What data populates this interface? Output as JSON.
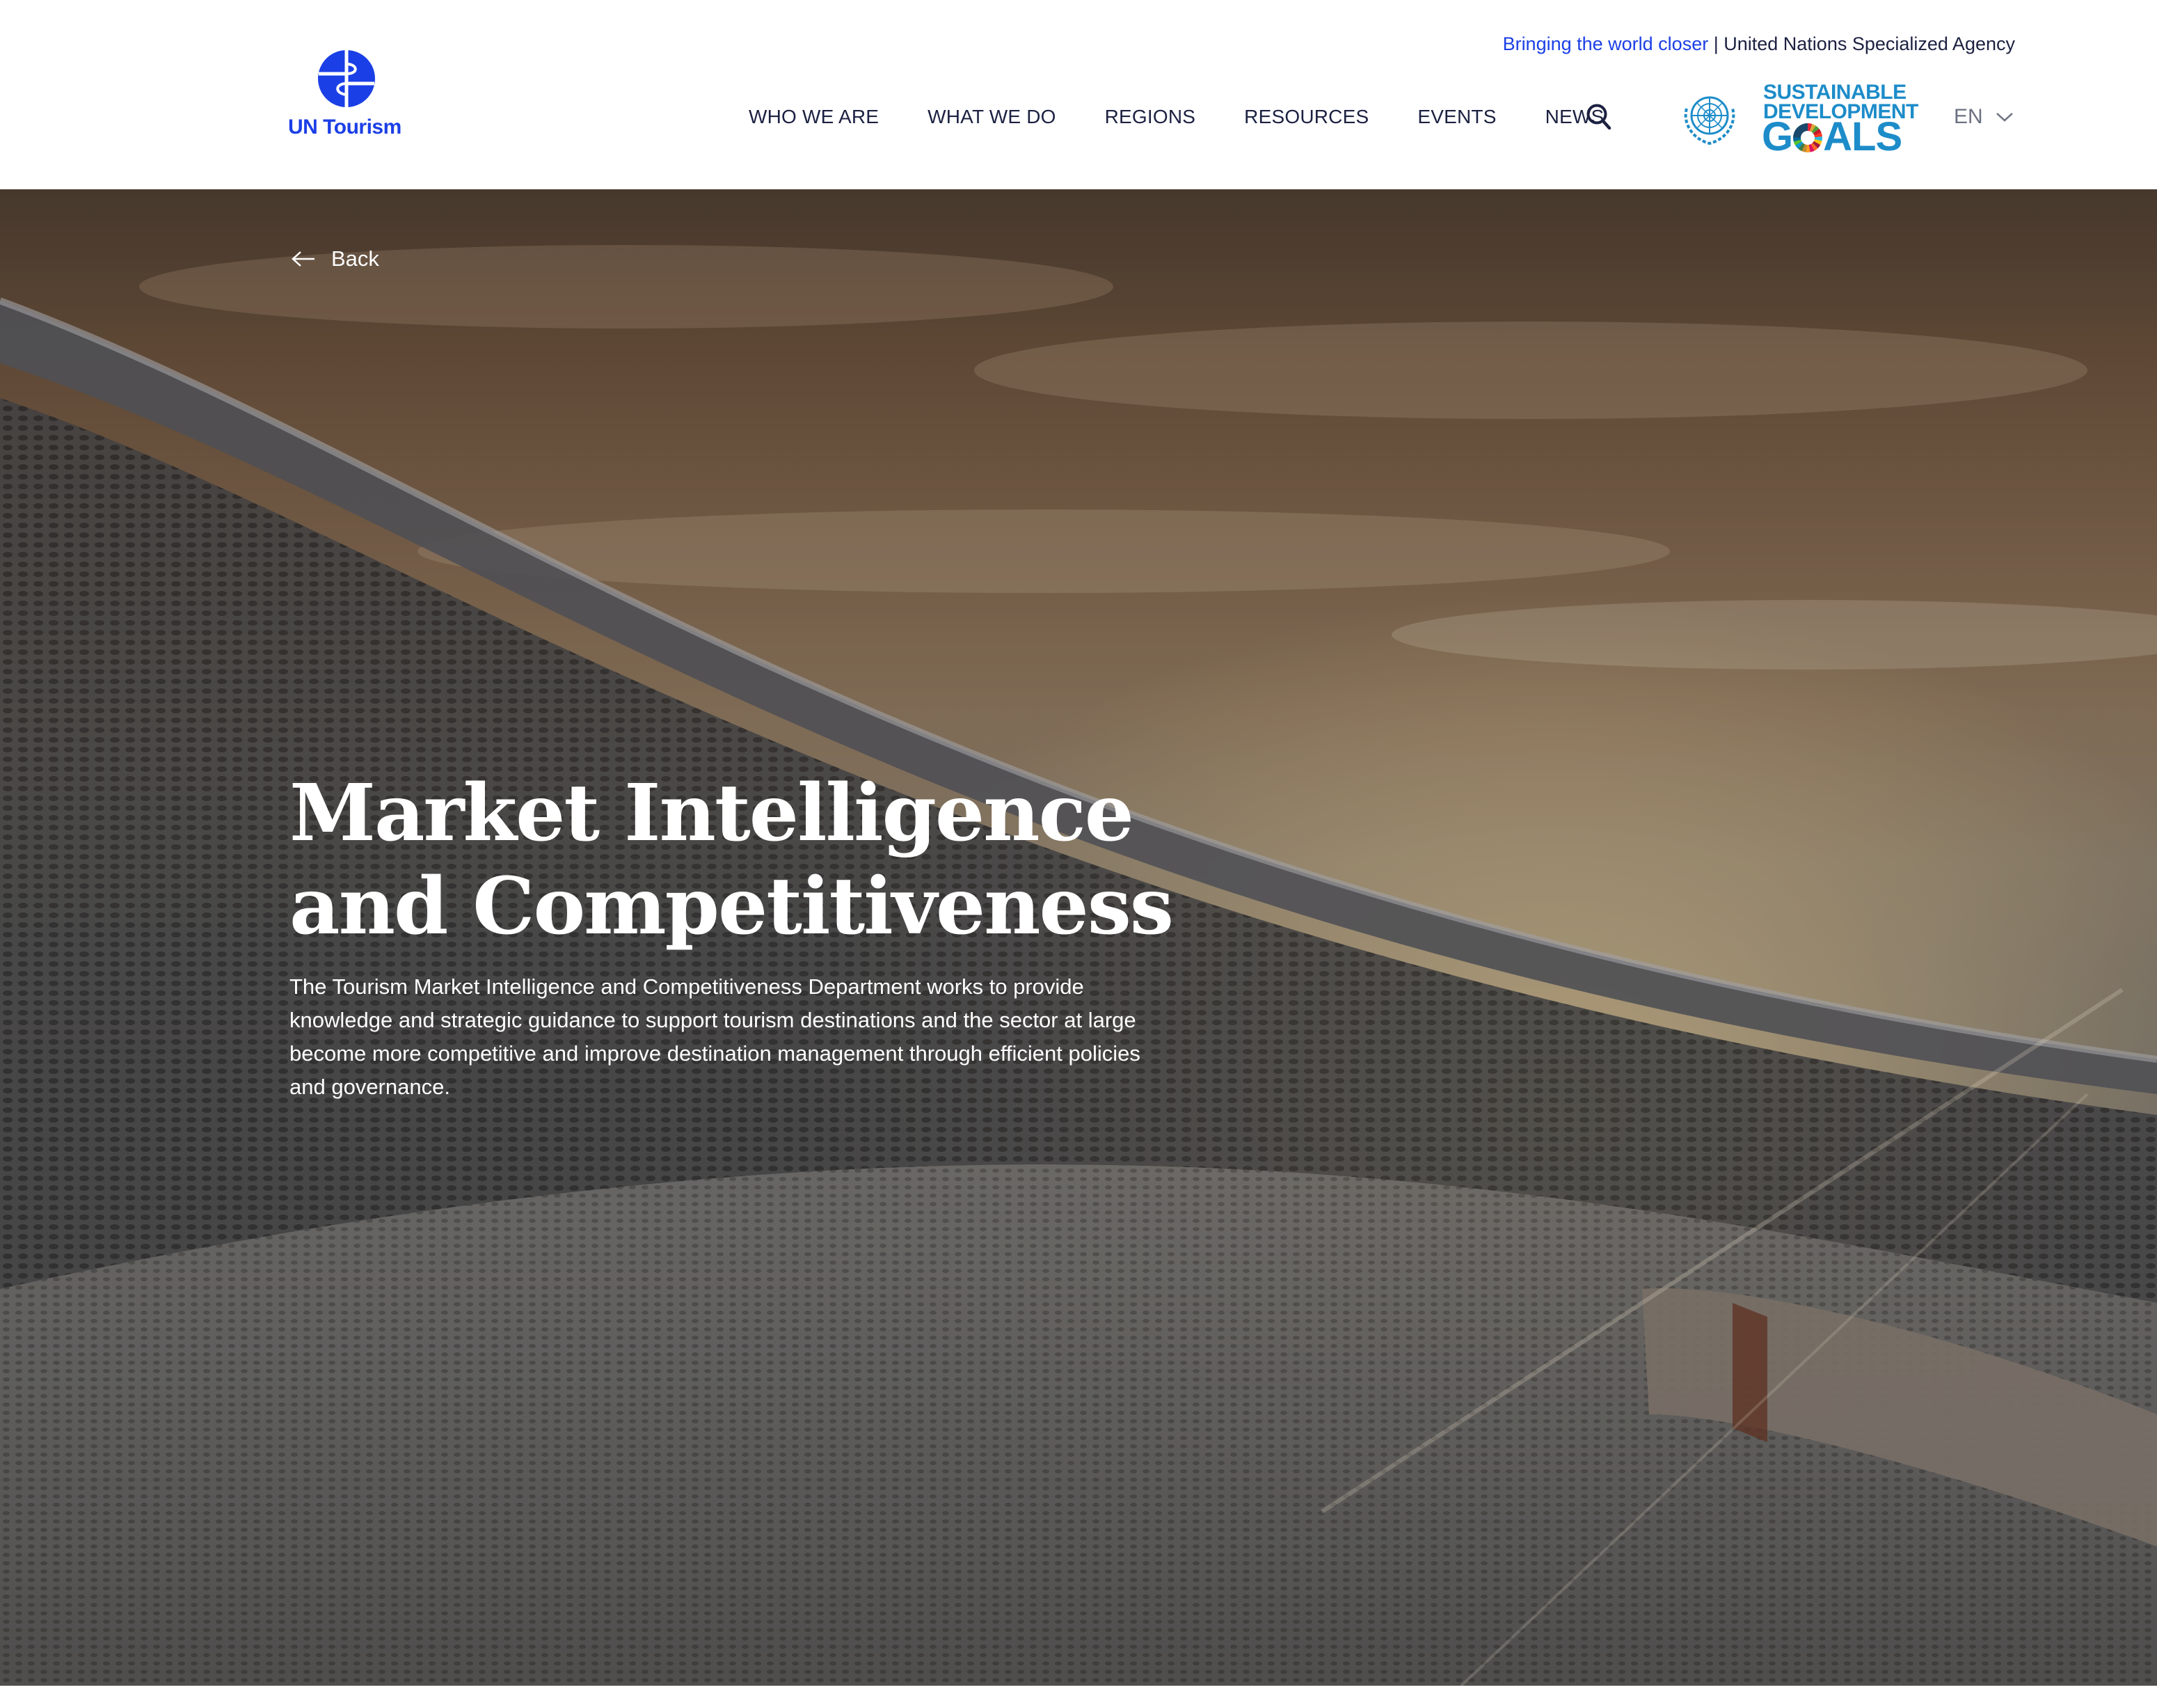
{
  "header": {
    "logo_text": "UN Tourism",
    "tagline_accent": "Bringing the world closer",
    "tagline_rest": " | United Nations Specialized Agency",
    "nav": [
      {
        "label": "WHO WE ARE"
      },
      {
        "label": "WHAT WE DO"
      },
      {
        "label": "REGIONS"
      },
      {
        "label": "RESOURCES"
      },
      {
        "label": "EVENTS"
      },
      {
        "label": "NEWS"
      }
    ],
    "search_icon": "search-icon",
    "sdg": {
      "line1": "SUSTAINABLE",
      "line2": "DEVELOPMENT",
      "goals_g": "G",
      "goals_rest": "ALS"
    },
    "language": "EN"
  },
  "hero": {
    "back_label": "Back",
    "title": "Market Intelligence and Competitiveness",
    "description": "The Tourism Market Intelligence and Competitiveness Department works to provide knowledge and strategic guidance to support tourism destinations and the sector at large become more competitive and improve destination management through efficient policies and governance."
  },
  "colors": {
    "brand_blue": "#1b3fe6",
    "nav_text": "#1c2141",
    "sdg_blue": "#1d8cc9",
    "hero_text": "#ffffff"
  }
}
